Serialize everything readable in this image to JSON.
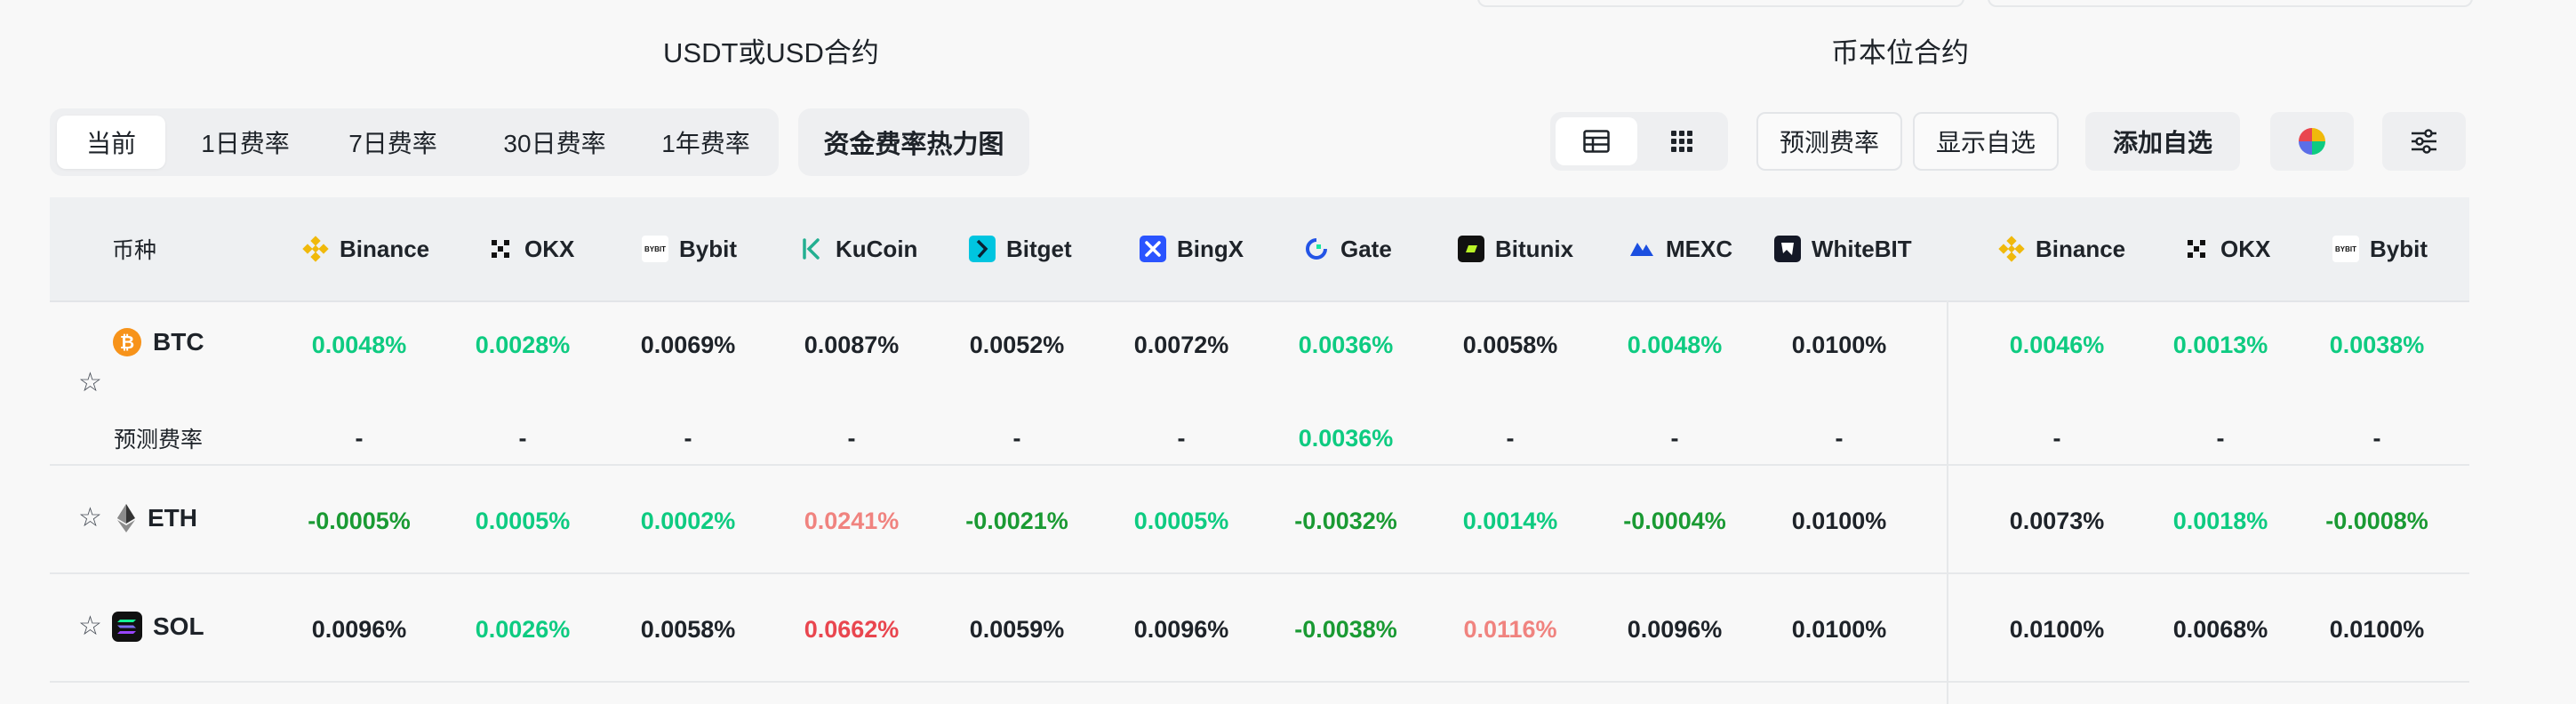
{
  "titles": {
    "usdt": "USDT或USD合约",
    "coin": "币本位合约"
  },
  "tabs": [
    "当前",
    "1日费率",
    "7日费率",
    "30日费率",
    "1年费率"
  ],
  "heatmap_button": "资金费率热力图",
  "buttons": {
    "predict": "预测费率",
    "show_fav": "显示自选",
    "add_fav": "添加自选"
  },
  "header": {
    "coin_label": "币种",
    "exchanges": [
      "Binance",
      "OKX",
      "Bybit",
      "KuCoin",
      "Bitget",
      "BingX",
      "Gate",
      "Bitunix",
      "MEXC",
      "WhiteBIT",
      "Binance",
      "OKX",
      "Bybit"
    ]
  },
  "rows": [
    {
      "symbol": "BTC",
      "rates": [
        "0.0048%",
        "0.0028%",
        "0.0069%",
        "0.0087%",
        "0.0052%",
        "0.0072%",
        "0.0036%",
        "0.0058%",
        "0.0048%",
        "0.0100%",
        "0.0046%",
        "0.0013%",
        "0.0038%"
      ],
      "colors": [
        "g",
        "g",
        "k",
        "k",
        "k",
        "k",
        "g",
        "k",
        "g",
        "k",
        "g",
        "g",
        "g"
      ],
      "predicted_label": "预测费率",
      "predicted": [
        "-",
        "-",
        "-",
        "-",
        "-",
        "-",
        "0.0036%",
        "-",
        "-",
        "-",
        "-",
        "-",
        "-"
      ],
      "predicted_colors": [
        "k",
        "k",
        "k",
        "k",
        "k",
        "k",
        "g",
        "k",
        "k",
        "k",
        "k",
        "k",
        "k"
      ]
    },
    {
      "symbol": "ETH",
      "rates": [
        "-0.0005%",
        "0.0005%",
        "0.0002%",
        "0.0241%",
        "-0.0021%",
        "0.0005%",
        "-0.0032%",
        "0.0014%",
        "-0.0004%",
        "0.0100%",
        "0.0073%",
        "0.0018%",
        "-0.0008%"
      ],
      "colors": [
        "dg",
        "g",
        "g",
        "lr",
        "dg",
        "g",
        "dg",
        "g",
        "dg",
        "k",
        "k",
        "g",
        "dg"
      ]
    },
    {
      "symbol": "SOL",
      "rates": [
        "0.0096%",
        "0.0026%",
        "0.0058%",
        "0.0662%",
        "0.0059%",
        "0.0096%",
        "-0.0038%",
        "0.0116%",
        "0.0096%",
        "0.0100%",
        "0.0100%",
        "0.0068%",
        "0.0100%"
      ],
      "colors": [
        "k",
        "g",
        "k",
        "r",
        "k",
        "k",
        "dg",
        "lr",
        "k",
        "k",
        "k",
        "k",
        "k"
      ]
    }
  ],
  "colors": {
    "positive": "#0ecb81",
    "negative": "#1a9a33",
    "high": "#e9464f",
    "elevated": "#f0837f"
  },
  "icons": {
    "exchanges": [
      "binance-icon",
      "okx-icon",
      "bybit-icon",
      "kucoin-icon",
      "bitget-icon",
      "bingx-icon",
      "gate-icon",
      "bitunix-icon",
      "mexc-icon",
      "whitebit-icon",
      "binance-icon",
      "okx-icon",
      "bybit-icon"
    ],
    "coins": [
      "btc-icon",
      "eth-icon",
      "sol-icon"
    ],
    "toolbar": [
      "table-view-icon",
      "grid-view-icon",
      "color-wheel-icon",
      "filter-settings-icon"
    ]
  }
}
